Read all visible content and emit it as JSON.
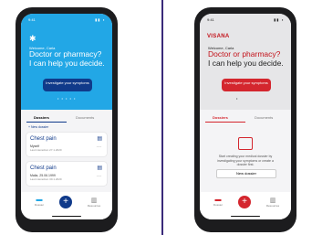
{
  "left_app": {
    "status_time": "9:41",
    "welcome": "Welcome, Carla",
    "headline_line1": "Doctor or pharmacy?",
    "headline_line2": "I can help you decide.",
    "cta_label": "Investigate your symptoms",
    "tab_dossiers": "Dossiers",
    "tab_documents": "Documents",
    "add_dossier": "+ New dossier",
    "cards": [
      {
        "title": "Chest pain",
        "subject": "Myself",
        "date": "Last interaction 27.1.2020"
      },
      {
        "title": "Chest pain",
        "subject": "Malia, 25.06.1999",
        "date": "Last interaction 30.1.2020"
      }
    ],
    "nav_dossier": "Dossier",
    "nav_resources": "Resources"
  },
  "right_app": {
    "status_time": "9:41",
    "brand": "VISANA",
    "welcome": "Welcome, Carla",
    "headline_line1": "Doctor or pharmacy?",
    "headline_line2": "I can help you decide.",
    "cta_label": "Investigate your symptoms",
    "tab_dossiers": "Dossiers",
    "tab_documents": "Documents",
    "empty_text": "Start creating your medical dossier by investigating your symptoms or create a dossier first.",
    "new_dossier": "New dossier",
    "nav_dossier": "Dossier",
    "nav_resources": "Resources"
  },
  "colors": {
    "left_primary": "#22a7e6",
    "left_dark": "#103a8a",
    "right_primary": "#d4262e",
    "divider": "#3a2a7a"
  }
}
